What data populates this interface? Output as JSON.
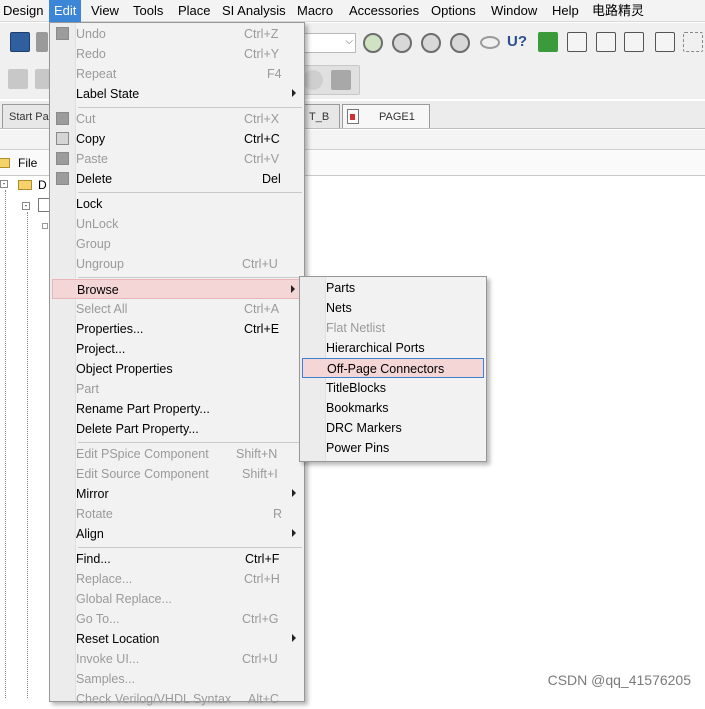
{
  "menubar": {
    "items": [
      "Design",
      "Edit",
      "View",
      "Tools",
      "Place",
      "SI Analysis",
      "Macro",
      "Accessories",
      "Options",
      "Window",
      "Help",
      "电路精灵"
    ]
  },
  "tabs": {
    "start": "Start Pa",
    "partial": "T_B",
    "page": "PAGE1"
  },
  "project_panel": {
    "file_label": "File",
    "tree_root": "D"
  },
  "edit_menu": {
    "undo": {
      "label": "Undo",
      "shortcut": "Ctrl+Z"
    },
    "redo": {
      "label": "Redo",
      "shortcut": "Ctrl+Y"
    },
    "repeat": {
      "label": "Repeat",
      "shortcut": "F4"
    },
    "label_state": {
      "label": "Label State"
    },
    "cut": {
      "label": "Cut",
      "shortcut": "Ctrl+X"
    },
    "copy": {
      "label": "Copy",
      "shortcut": "Ctrl+C"
    },
    "paste": {
      "label": "Paste",
      "shortcut": "Ctrl+V"
    },
    "delete": {
      "label": "Delete",
      "shortcut": "Del"
    },
    "lock": {
      "label": "Lock"
    },
    "unlock": {
      "label": "UnLock"
    },
    "group": {
      "label": "Group"
    },
    "ungroup": {
      "label": "Ungroup",
      "shortcut": "Ctrl+U"
    },
    "browse": {
      "label": "Browse"
    },
    "select_all": {
      "label": "Select All",
      "shortcut": "Ctrl+A"
    },
    "properties": {
      "label": "Properties...",
      "shortcut": "Ctrl+E"
    },
    "project": {
      "label": "Project..."
    },
    "object_properties": {
      "label": "Object Properties"
    },
    "part": {
      "label": "Part"
    },
    "rename_part_property": {
      "label": "Rename Part Property..."
    },
    "delete_part_property": {
      "label": "Delete Part Property..."
    },
    "edit_pspice": {
      "label": "Edit PSpice Component",
      "shortcut": "Shift+N"
    },
    "edit_source": {
      "label": "Edit Source Component",
      "shortcut": "Shift+I"
    },
    "mirror": {
      "label": "Mirror"
    },
    "rotate": {
      "label": "Rotate",
      "shortcut": "R"
    },
    "align": {
      "label": "Align"
    },
    "find": {
      "label": "Find...",
      "shortcut": "Ctrl+F"
    },
    "replace": {
      "label": "Replace...",
      "shortcut": "Ctrl+H"
    },
    "global_replace": {
      "label": "Global Replace..."
    },
    "go_to": {
      "label": "Go To...",
      "shortcut": "Ctrl+G"
    },
    "reset_location": {
      "label": "Reset Location"
    },
    "invoke_ui": {
      "label": "Invoke UI...",
      "shortcut": "Ctrl+U"
    },
    "samples": {
      "label": "Samples..."
    },
    "check_verilog": {
      "label": "Check Verilog/VHDL Syntax",
      "shortcut": "Alt+C"
    }
  },
  "browse_menu": {
    "items": [
      "Parts",
      "Nets",
      "Flat Netlist",
      "Hierarchical Ports",
      "Off-Page Connectors",
      "TitleBlocks",
      "Bookmarks",
      "DRC Markers",
      "Power Pins"
    ]
  },
  "watermark": "CSDN @qq_41576205",
  "colors": {
    "menu_highlight": "#f5d6d6",
    "menubar_active": "#3b86d6",
    "focus_border": "#3f7fd0"
  }
}
